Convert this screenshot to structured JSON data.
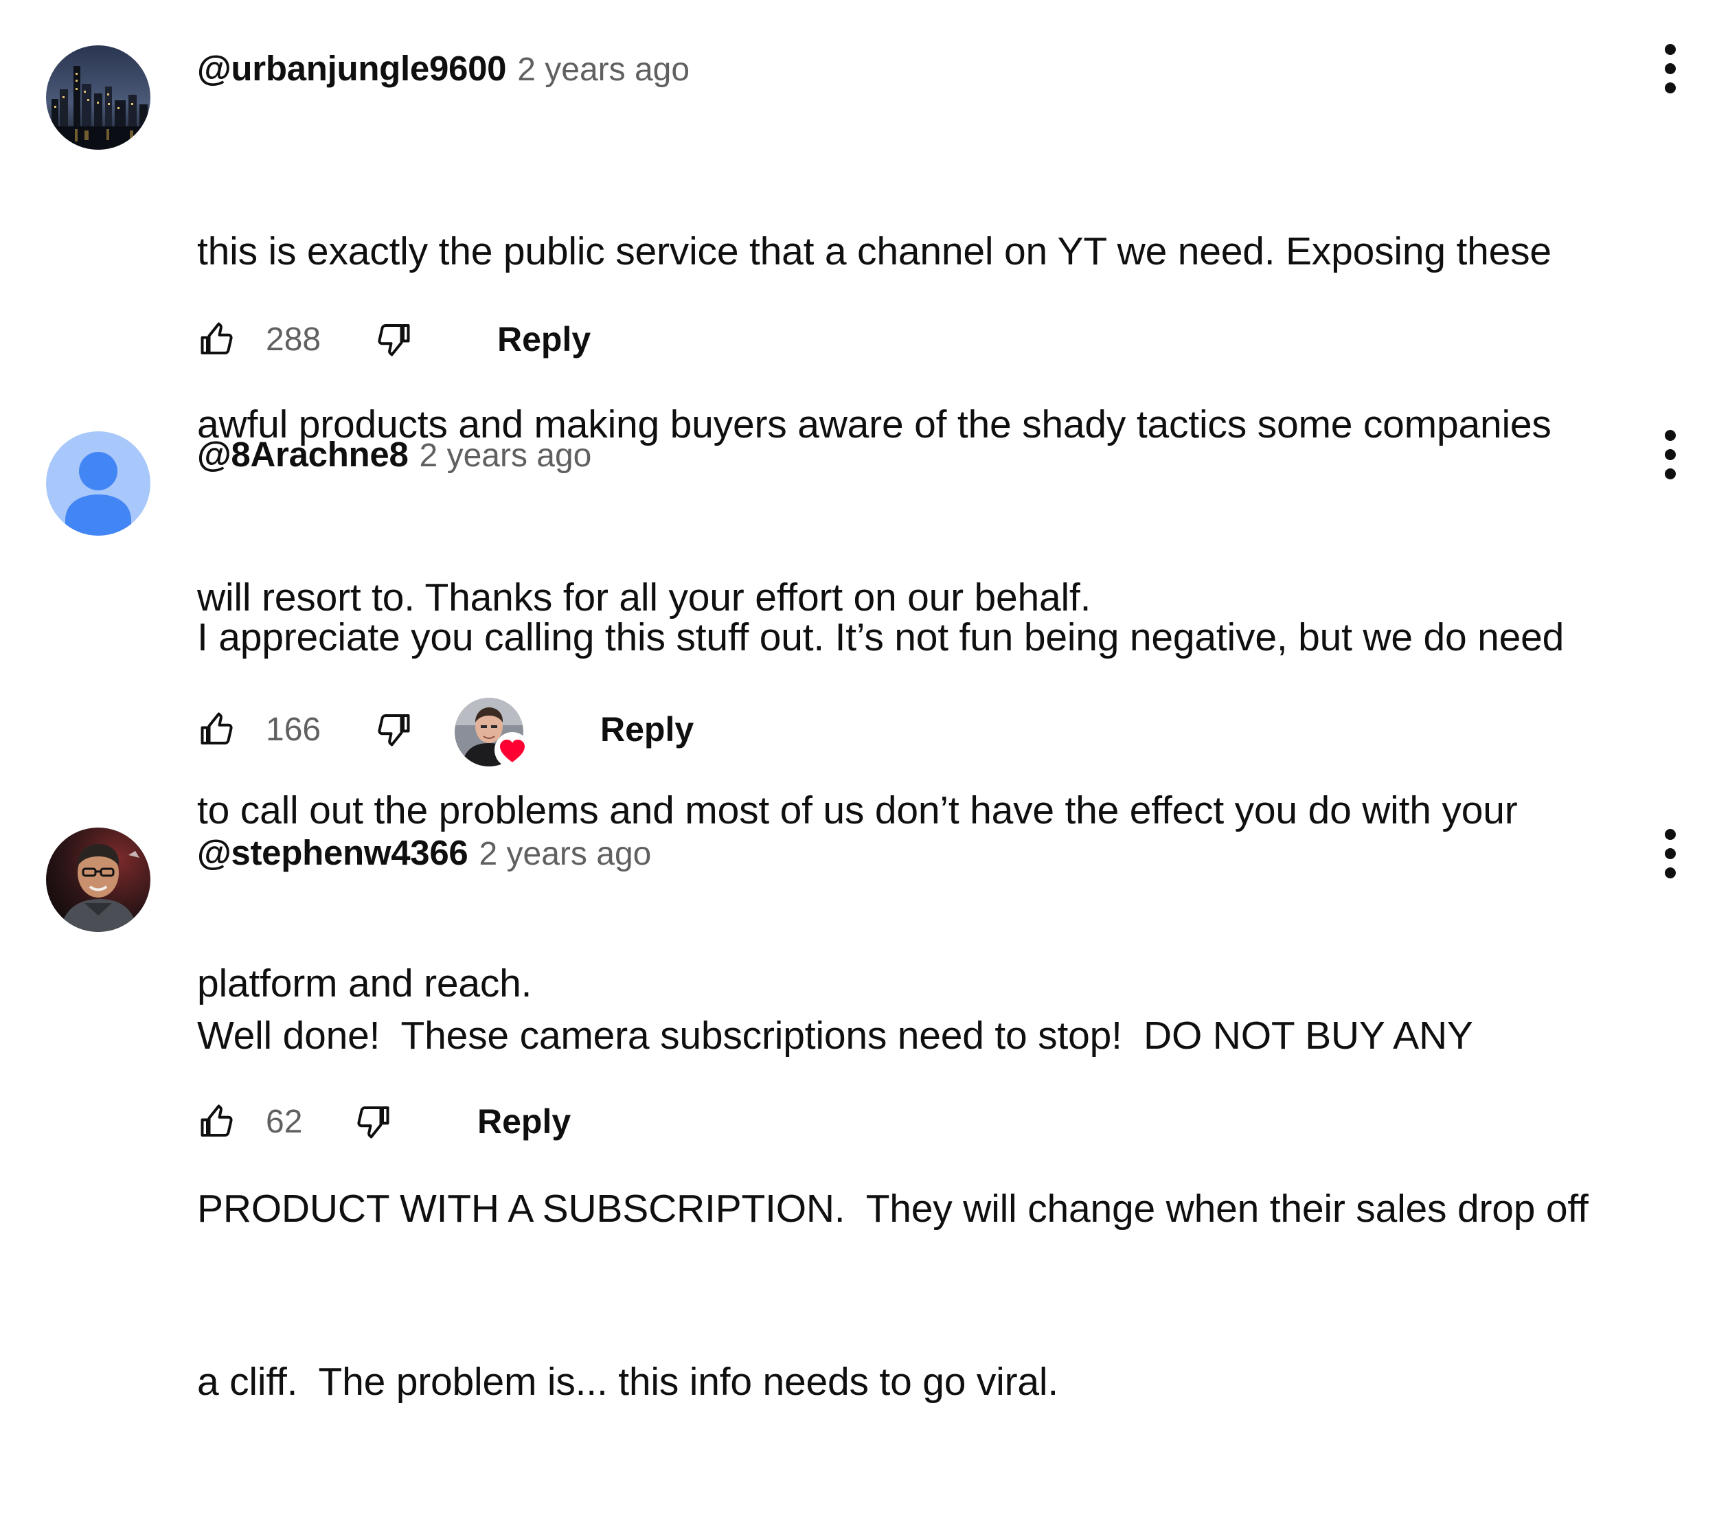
{
  "comments": [
    {
      "author": "@urbanjungle9600",
      "time": "2 years ago",
      "lines": [
        "this is exactly the public service that a channel on YT we need. Exposing these",
        "awful products and making buyers aware of the shady tactics some companies",
        "will resort to. Thanks for all your effort on our behalf."
      ],
      "likes": "288",
      "reply_label": "Reply",
      "avatar": "city-night-skyline"
    },
    {
      "author": "@8Arachne8",
      "time": "2 years ago",
      "lines": [
        "I appreciate you calling this stuff out. It’s not fun being negative, but we do need",
        "to call out the problems and most of us don’t have the effect you do with your",
        "platform and reach."
      ],
      "likes": "166",
      "reply_label": "Reply",
      "avatar": "default-person-avatar",
      "creator_heart": true
    },
    {
      "author": "@stephenw4366",
      "time": "2 years ago",
      "lines": [
        "Well done!  These camera subscriptions need to stop!  DO NOT BUY ANY",
        "PRODUCT WITH A SUBSCRIPTION.  They will change when their sales drop off",
        "a cliff.  The problem is... this info needs to go viral."
      ],
      "likes": "62",
      "reply_label": "Reply",
      "avatar": "man-with-glasses-photo"
    }
  ],
  "icons": {
    "like": "thumbs-up-icon",
    "dislike": "thumbs-down-icon",
    "more": "vertical-ellipsis-icon",
    "heart": "heart-icon"
  },
  "colors": {
    "text": "#0f0f0f",
    "secondary": "#606060",
    "heart": "#ff0033",
    "default_avatar_bg": "#a8c7fa",
    "default_avatar_fg": "#4285f4"
  }
}
